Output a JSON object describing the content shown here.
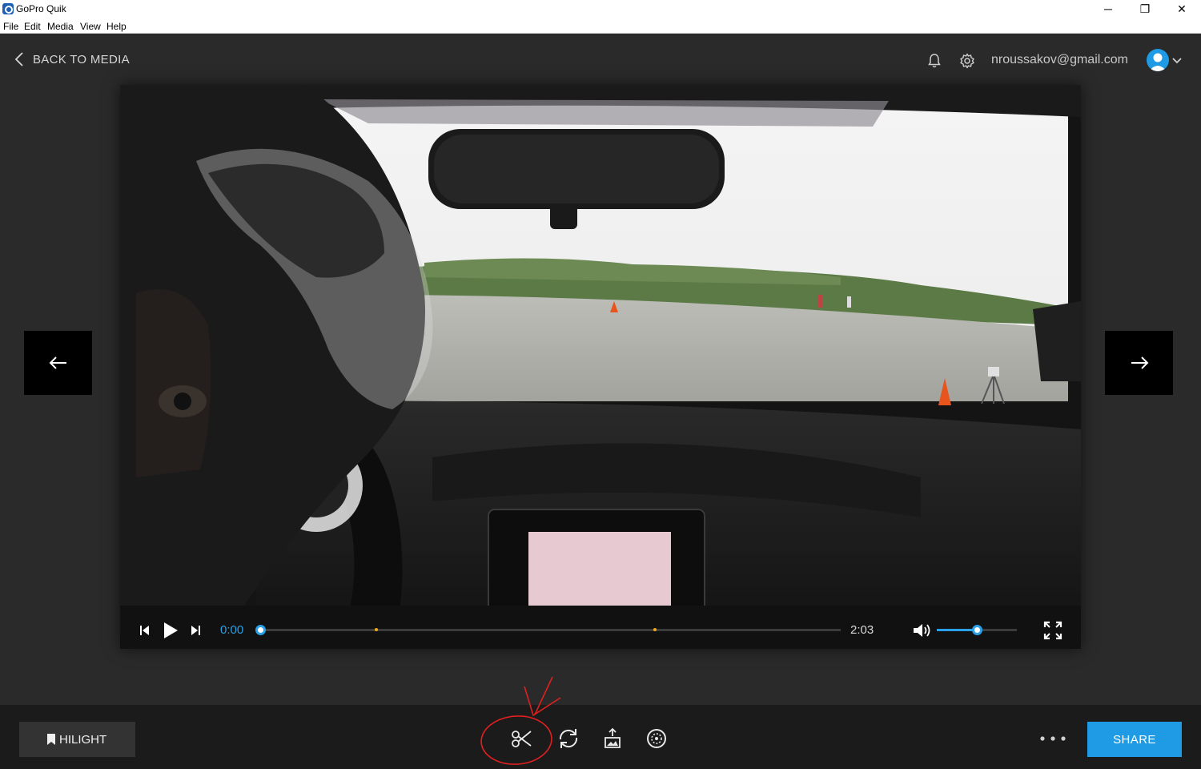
{
  "window": {
    "title": "GoPro Quik",
    "controls": {
      "minimize": "─",
      "maximize": "❐",
      "close": "✕"
    }
  },
  "menu": [
    "File",
    "Edit",
    "Media",
    "View",
    "Help"
  ],
  "header": {
    "back_label": "BACK TO MEDIA",
    "account_email": "nroussakov@gmail.com",
    "icons": [
      "bell-icon",
      "gear-icon",
      "user-avatar-icon",
      "chevron-down-icon"
    ]
  },
  "player": {
    "current_time": "0:00",
    "total_time": "2:03",
    "progress": 0,
    "highlight_markers": [
      0.2,
      0.68
    ],
    "volume": 0.5,
    "icons": [
      "skip-back-icon",
      "play-icon",
      "skip-forward-icon",
      "volume-icon",
      "fullscreen-icon"
    ]
  },
  "navigation": {
    "prev_icon": "arrow-left-icon",
    "next_icon": "arrow-right-icon"
  },
  "bottom_bar": {
    "hilight_label": "HILIGHT",
    "tools": [
      "scissors-icon",
      "repeat-icon",
      "frame-grab-icon",
      "speed-icon"
    ],
    "more_icon": "more-dots-icon",
    "share_label": "SHARE"
  },
  "colors": {
    "accent": "#1e9be4",
    "background": "#2a2a2a",
    "bottom_bar": "#1b1b1b",
    "annotation": "#e02020"
  }
}
